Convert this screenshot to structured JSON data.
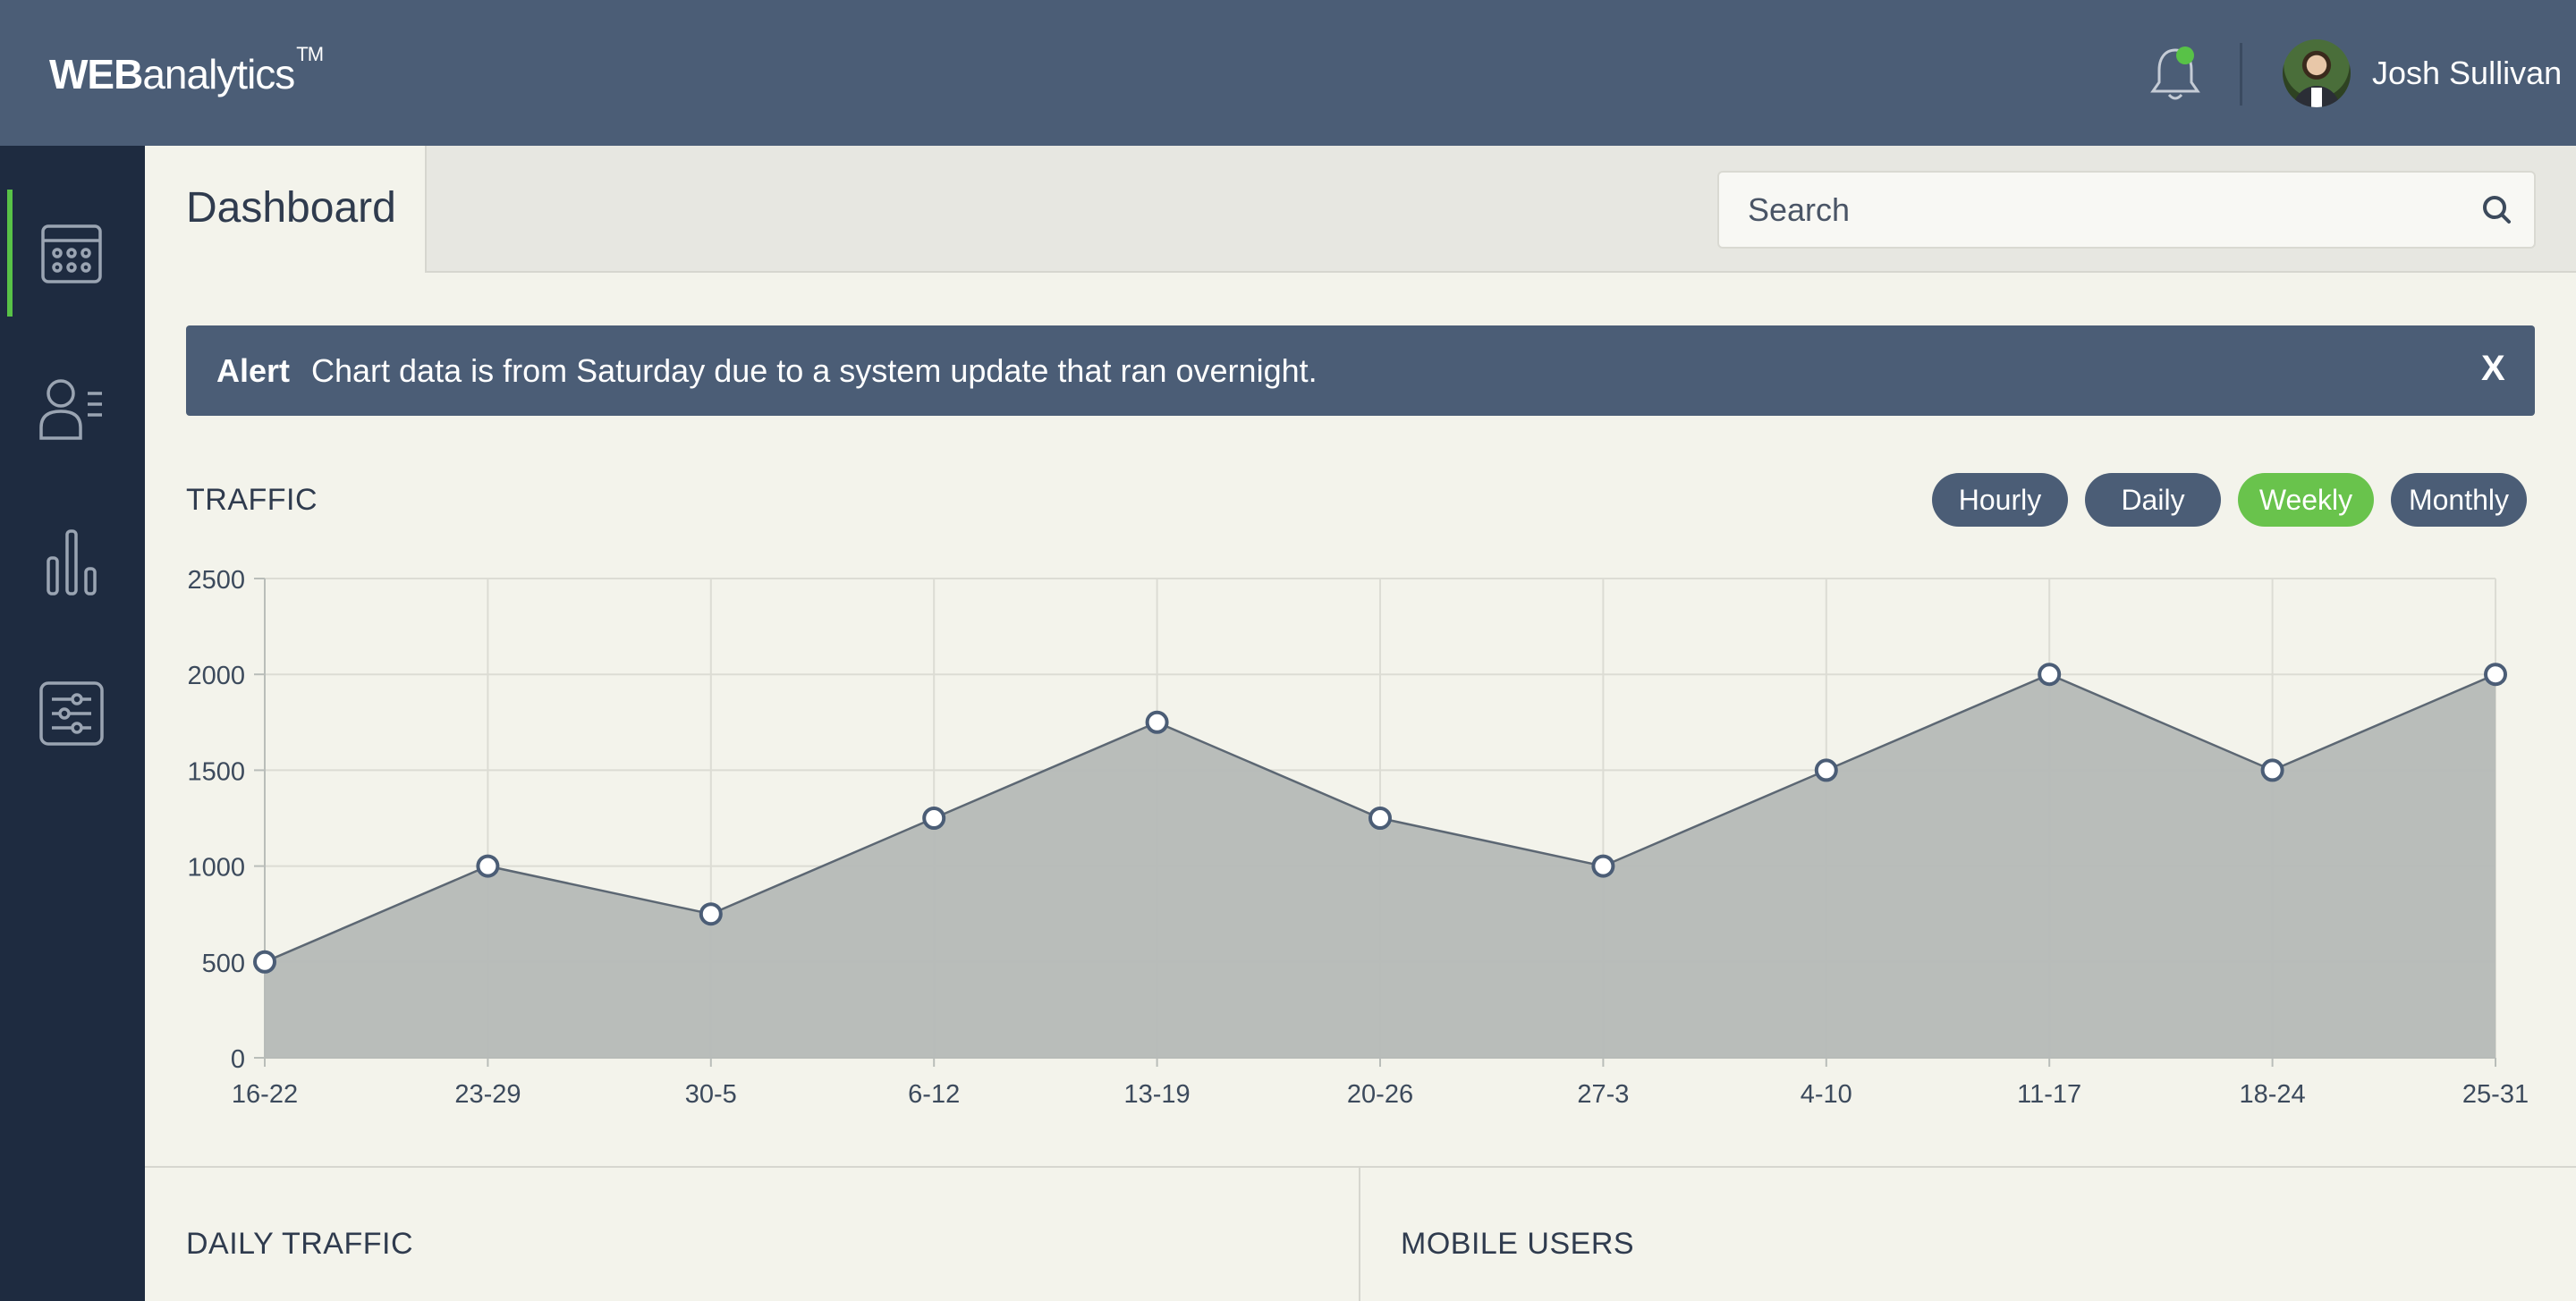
{
  "app": {
    "logo_bold": "WEB",
    "logo_light": "analytics",
    "logo_tm": "TM"
  },
  "user": {
    "name": "Josh Sullivan"
  },
  "page": {
    "title": "Dashboard"
  },
  "search": {
    "placeholder": "Search"
  },
  "alert": {
    "title": "Alert",
    "message": "Chart data is from Saturday due to a system update that ran overnight.",
    "close_label": "X"
  },
  "traffic": {
    "title": "TRAFFIC",
    "ranges": [
      {
        "label": "Hourly",
        "active": false
      },
      {
        "label": "Daily",
        "active": false
      },
      {
        "label": "Weekly",
        "active": true
      },
      {
        "label": "Monthly",
        "active": false
      }
    ]
  },
  "panels": {
    "daily_traffic": "DAILY TRAFFIC",
    "mobile_users": "MOBILE USERS"
  },
  "colors": {
    "header": "#4b5d76",
    "sidebar": "#1e2b40",
    "accent_green": "#69c34c",
    "area_fill": "#b5b9b7",
    "line": "#5c6773"
  },
  "chart_data": {
    "type": "area",
    "categories": [
      "16-22",
      "23-29",
      "30-5",
      "6-12",
      "13-19",
      "20-26",
      "27-3",
      "4-10",
      "11-17",
      "18-24",
      "25-31"
    ],
    "values": [
      500,
      1000,
      750,
      1250,
      1750,
      1250,
      1000,
      1500,
      2000,
      1500,
      2000
    ],
    "ylim": [
      0,
      2500
    ],
    "yticks": [
      0,
      500,
      1000,
      1500,
      2000,
      2500
    ],
    "grid": true,
    "title": "",
    "xlabel": "",
    "ylabel": ""
  }
}
